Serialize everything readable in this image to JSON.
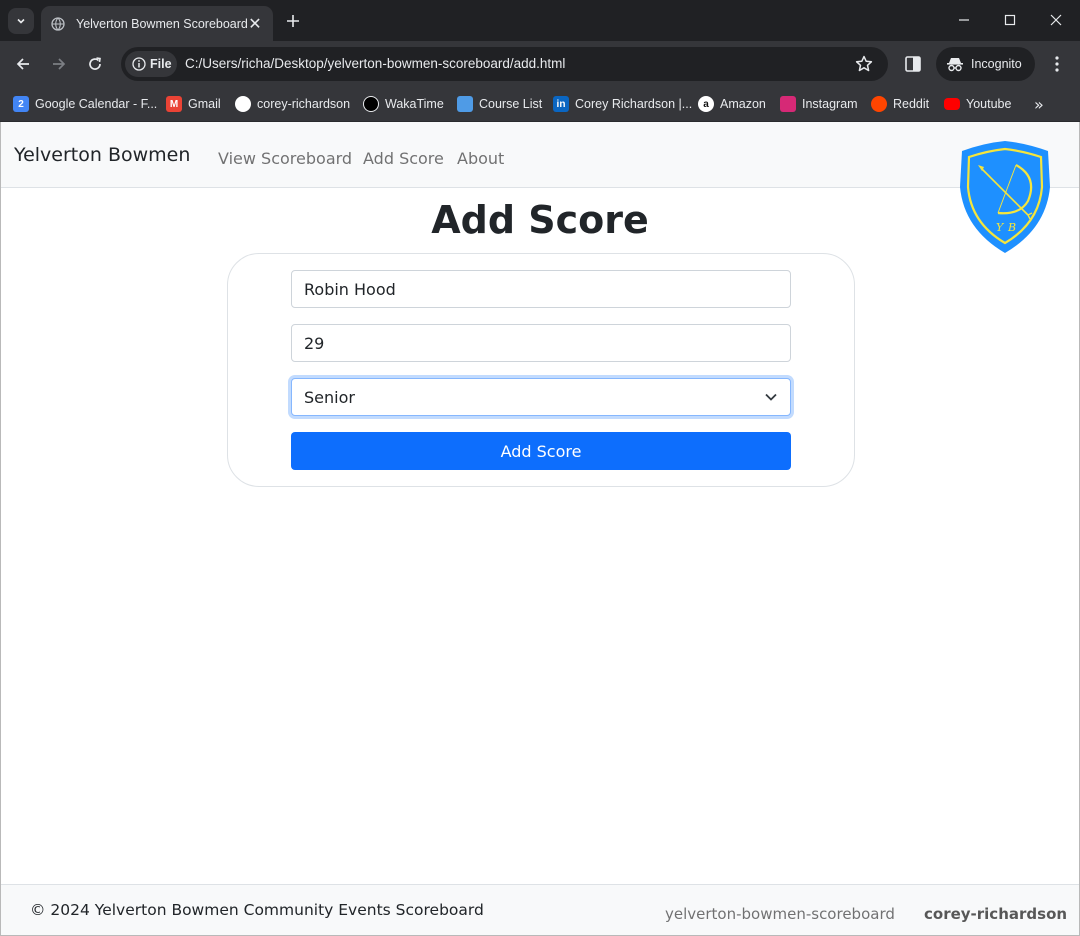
{
  "browser": {
    "tab_title": "Yelverton Bowmen Scoreboard",
    "site_chip": "File",
    "url": "C:/Users/richa/Desktop/yelverton-bowmen-scoreboard/add.html",
    "profile": "Incognito",
    "bookmarks": [
      {
        "label": "Google Calendar - F...",
        "icon": "google-calendar-icon",
        "color": "#4285f4",
        "glyph": "2"
      },
      {
        "label": "Gmail",
        "icon": "gmail-icon",
        "color": "#ea4335",
        "glyph": "M"
      },
      {
        "label": "corey-richardson",
        "icon": "github-icon",
        "color": "#ffffff",
        "glyph": ""
      },
      {
        "label": "WakaTime",
        "icon": "wakatime-icon",
        "color": "#000000",
        "glyph": ""
      },
      {
        "label": "Course List",
        "icon": "course-list-icon",
        "color": "#4f9be6",
        "glyph": ""
      },
      {
        "label": "Corey Richardson |...",
        "icon": "linkedin-icon",
        "color": "#0a66c2",
        "glyph": "in"
      },
      {
        "label": "Amazon",
        "icon": "amazon-icon",
        "color": "#ffffff",
        "glyph": "a"
      },
      {
        "label": "Instagram",
        "icon": "instagram-icon",
        "color": "#d62976",
        "glyph": ""
      },
      {
        "label": "Reddit",
        "icon": "reddit-icon",
        "color": "#ff4500",
        "glyph": ""
      },
      {
        "label": "Youtube",
        "icon": "youtube-icon",
        "color": "#ff0000",
        "glyph": ""
      }
    ]
  },
  "navbar": {
    "brand": "Yelverton Bowmen",
    "links": [
      "View Scoreboard",
      "Add Score",
      "About"
    ]
  },
  "main": {
    "heading": "Add Score",
    "form": {
      "name_value": "Robin Hood",
      "score_value": "29",
      "category_selected": "Senior",
      "submit_label": "Add Score"
    }
  },
  "footer": {
    "copyright": "© 2024 Yelverton Bowmen Community Events Scoreboard",
    "links": [
      "yelverton-bowmen-scoreboard",
      "corey-richardson"
    ]
  },
  "colors": {
    "primary": "#0d6efd",
    "logo_shield": "#1e90ff",
    "logo_trim": "#f5e53c"
  }
}
